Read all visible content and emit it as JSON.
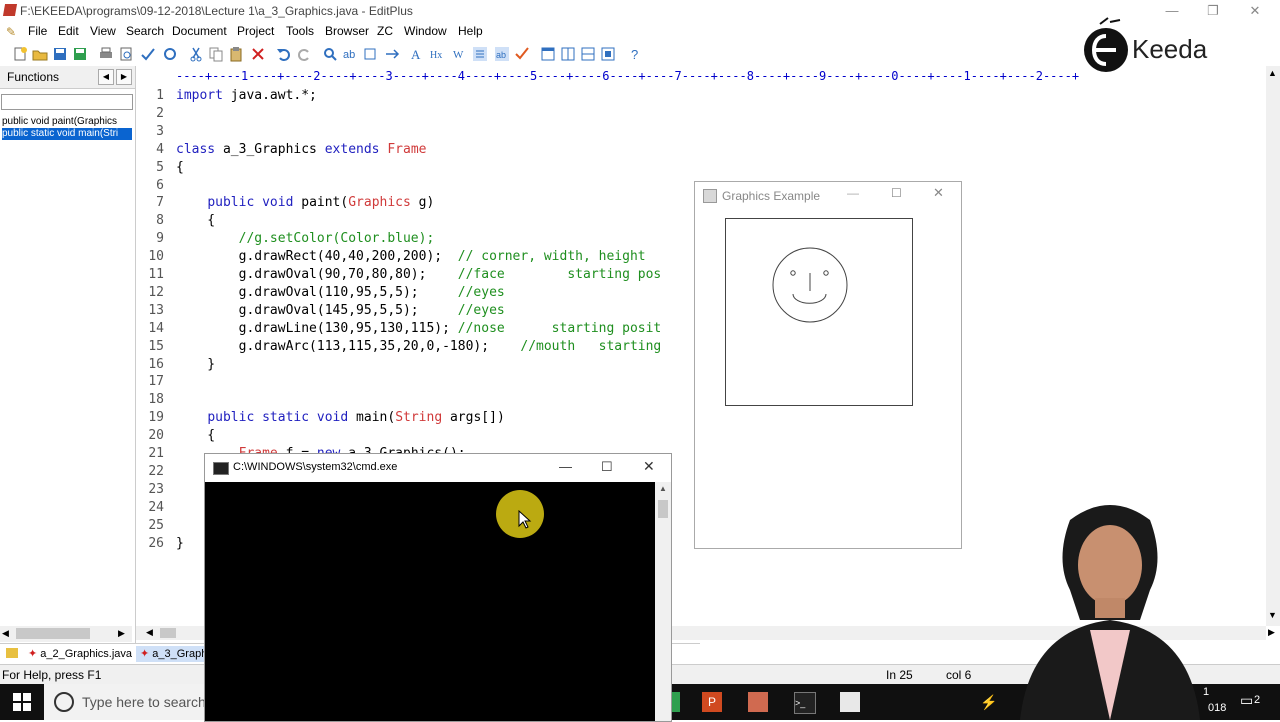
{
  "window": {
    "title": "F:\\EKEEDA\\programs\\09-12-2018\\Lecture 1\\a_3_Graphics.java - EditPlus",
    "controls": [
      "—",
      "❐",
      "✕"
    ]
  },
  "menu": [
    "File",
    "Edit",
    "View",
    "Search",
    "Document",
    "Project",
    "Tools",
    "Browser",
    "ZC",
    "Window",
    "Help"
  ],
  "functions_panel": {
    "title": "Functions",
    "items": [
      "public void paint(Graphics",
      "public static void main(Stri"
    ]
  },
  "ruler": "----+----1----+----2----+----3----+----4----+----5----+----6----+----7----+----8----+----9----+----0----+----1----+----2----+",
  "code_lines": [
    {
      "n": "1",
      "text": "import java.awt.*;"
    },
    {
      "n": "2",
      "text": ""
    },
    {
      "n": "3",
      "text": ""
    },
    {
      "n": "4",
      "text": "class a_3_Graphics extends Frame"
    },
    {
      "n": "5",
      "text": "{"
    },
    {
      "n": "6",
      "text": ""
    },
    {
      "n": "7",
      "text": "    public void paint(Graphics g)"
    },
    {
      "n": "8",
      "text": "    {"
    },
    {
      "n": "9",
      "text": "        //g.setColor(Color.blue);"
    },
    {
      "n": "10",
      "text": "        g.drawRect(40,40,200,200);  // corner, width, height"
    },
    {
      "n": "11",
      "text": "        g.drawOval(90,70,80,80);    //face        starting pos"
    },
    {
      "n": "12",
      "text": "        g.drawOval(110,95,5,5);     //eyes"
    },
    {
      "n": "13",
      "text": "        g.drawOval(145,95,5,5);     //eyes"
    },
    {
      "n": "14",
      "text": "        g.drawLine(130,95,130,115); //nose      starting posit"
    },
    {
      "n": "15",
      "text": "        g.drawArc(113,115,35,20,0,-180);    //mouth   starting"
    },
    {
      "n": "16",
      "text": "    }"
    },
    {
      "n": "17",
      "text": ""
    },
    {
      "n": "18",
      "text": ""
    },
    {
      "n": "19",
      "text": "    public static void main(String args[])"
    },
    {
      "n": "20",
      "text": "    {"
    },
    {
      "n": "21",
      "text": "        Frame f = new a_3_Graphics();"
    },
    {
      "n": "22",
      "text": ""
    },
    {
      "n": "23",
      "text": ""
    },
    {
      "n": "24",
      "text": ""
    },
    {
      "n": "25",
      "text": ""
    },
    {
      "n": "26",
      "text": "}"
    }
  ],
  "tabs": [
    "a_2_Graphics.java",
    "a_3_Graphi"
  ],
  "status": {
    "message": "For Help, press F1",
    "line": "In 25",
    "col": "col 6"
  },
  "graphics_window": {
    "title": "Graphics Example"
  },
  "cmd_window": {
    "title": "C:\\WINDOWS\\system32\\cmd.exe"
  },
  "taskbar": {
    "search_placeholder": "Type here to search",
    "time_fragment": "018",
    "notify_count": "2",
    "time_top": "1"
  },
  "logo": {
    "text": "Keeda"
  },
  "colors": {
    "keyword": "#1f1fbf",
    "type": "#d03a3a",
    "comment": "#1f8f1f",
    "selection": "#0a64d0"
  }
}
